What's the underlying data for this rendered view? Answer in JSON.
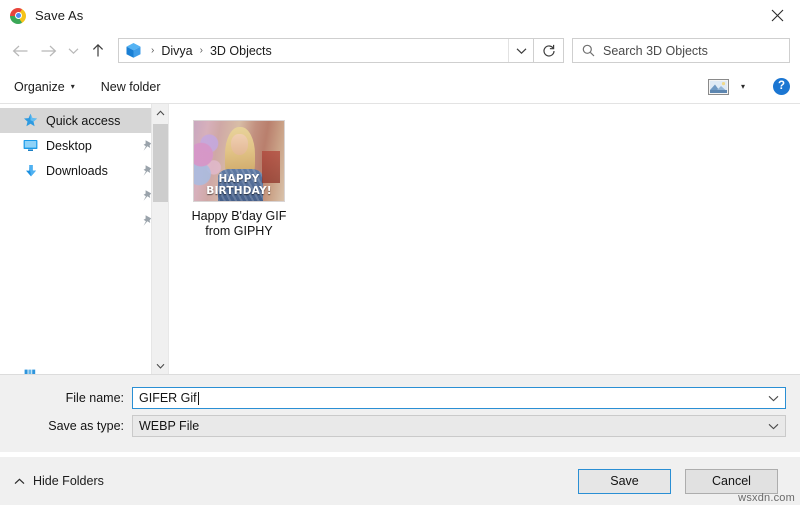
{
  "window": {
    "title": "Save As",
    "app_icon": "chrome-icon",
    "close_label": "✕"
  },
  "nav": {
    "back_icon": "back-arrow-icon",
    "forward_icon": "forward-arrow-icon",
    "recent_icon": "chevron-down-icon",
    "up_icon": "up-arrow-icon",
    "breadcrumb": {
      "root_icon": "3d-objects-cube-icon",
      "items": [
        {
          "label": "Divya"
        },
        {
          "label": "3D Objects"
        }
      ],
      "separator": "›",
      "dropdown_icon": "chevron-down-icon"
    },
    "refresh_icon": "refresh-icon",
    "search": {
      "icon": "search-icon",
      "placeholder": "Search 3D Objects",
      "value": ""
    }
  },
  "toolbar": {
    "organize_label": "Organize",
    "organize_caret": "▾",
    "new_folder_label": "New folder",
    "view_icon": "view-mode-icon",
    "view_caret": "▾",
    "help_label": "?"
  },
  "sidebar": {
    "items": [
      {
        "label": "Quick access",
        "icon": "star-icon",
        "selected": true,
        "pinned": false
      },
      {
        "label": "Desktop",
        "icon": "desktop-monitor-icon",
        "selected": false,
        "pinned": true
      },
      {
        "label": "Downloads",
        "icon": "download-arrow-icon",
        "selected": false,
        "pinned": true
      }
    ],
    "extra_pins": 2,
    "clipped_item": {
      "label": "",
      "icon": "library-icon"
    },
    "scrollbar": {
      "up_arrow": "˄",
      "down_arrow": "˅"
    }
  },
  "files": {
    "items": [
      {
        "name": "Happy B'day GIF\nfrom GIPHY",
        "name_line1": "Happy B'day GIF",
        "name_line2": "from GIPHY",
        "thumbnail_caption_line1": "HAPPY",
        "thumbnail_caption_line2": "BIRTHDAY!",
        "thumbnail": "happy-birthday-gif-thumbnail"
      }
    ]
  },
  "form": {
    "file_name_label": "File name:",
    "file_name_value": "GIFER Gif",
    "file_name_focused": true,
    "save_as_type_label": "Save as type:",
    "save_as_type_value": "WEBP File",
    "dropdown_icon": "chevron-down-icon"
  },
  "footer": {
    "hide_folders_label": "Hide Folders",
    "hide_folders_icon": "chevron-up-icon",
    "save_label": "Save",
    "cancel_label": "Cancel"
  },
  "watermark": {
    "text": "wsxdn.com"
  },
  "colors": {
    "accent_blue": "#2a8fd4",
    "help_blue": "#1b76d2",
    "selection_gray": "#d6d6d6",
    "panel_gray": "#f0f0f0"
  }
}
